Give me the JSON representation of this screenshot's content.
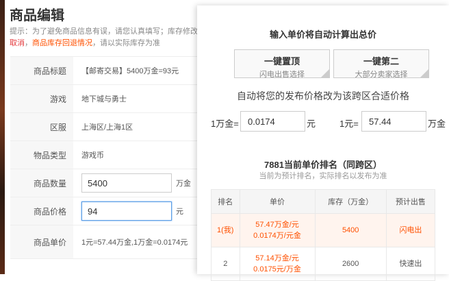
{
  "page": {
    "title": "商品编辑",
    "notice_line1": "提示：为了避免商品信息有误，请您认真填写；库存修改",
    "notice_red": "取消",
    "notice_sep": "，",
    "notice_link": "商品库存回退情况",
    "notice_tail": "，请以实际库存为准"
  },
  "form": {
    "rows": [
      {
        "label": "商品标题",
        "value": "【邮寄交易】5400万金=93元"
      },
      {
        "label": "游戏",
        "value": "地下城与勇士"
      },
      {
        "label": "区服",
        "value": "上海区/上海1区"
      },
      {
        "label": "物品类型",
        "value": "游戏币"
      }
    ],
    "quantity_label": "商品数量",
    "quantity_value": "5400",
    "quantity_unit": "万金",
    "price_label": "商品价格",
    "price_value": "94",
    "price_unit": "元",
    "unit_price_label": "商品单价",
    "unit_price_value": "1元=57.44万金,1万金=0.0174元"
  },
  "popup": {
    "title": "输入单价将自动计算出总价",
    "btn1_title": "一键置顶",
    "btn1_sub": "闪电出售选择",
    "btn2_title": "一键第二",
    "btn2_sub": "大部分卖家选择",
    "auto_text": "自动将您的发布价格改为该跨区合适价格",
    "calc1_prefix": "1万金=",
    "calc1_value": "0.0174",
    "calc1_unit": "元",
    "calc2_prefix": "1元=",
    "calc2_value": "57.44",
    "calc2_unit": "万金",
    "rank_title": "7881当前单价排名（同跨区）",
    "rank_sub": "当前为预计排名，实际排名以发布为准",
    "headers": [
      "排名",
      "单价",
      "库存（万金）",
      "预计出售"
    ],
    "rows": [
      {
        "rank": "1(我)",
        "price1": "57.47万金/元",
        "price2": "0.0174万/元金",
        "stock": "5400",
        "sale": "闪电出"
      },
      {
        "rank": "2",
        "price1": "57.14万金/元",
        "price2": "0.0175元/万金",
        "stock": "2600",
        "sale": "快速出"
      }
    ]
  },
  "colors": {
    "accent": "#ff5000",
    "red": "#e4393c",
    "focus": "#5a9de6"
  }
}
